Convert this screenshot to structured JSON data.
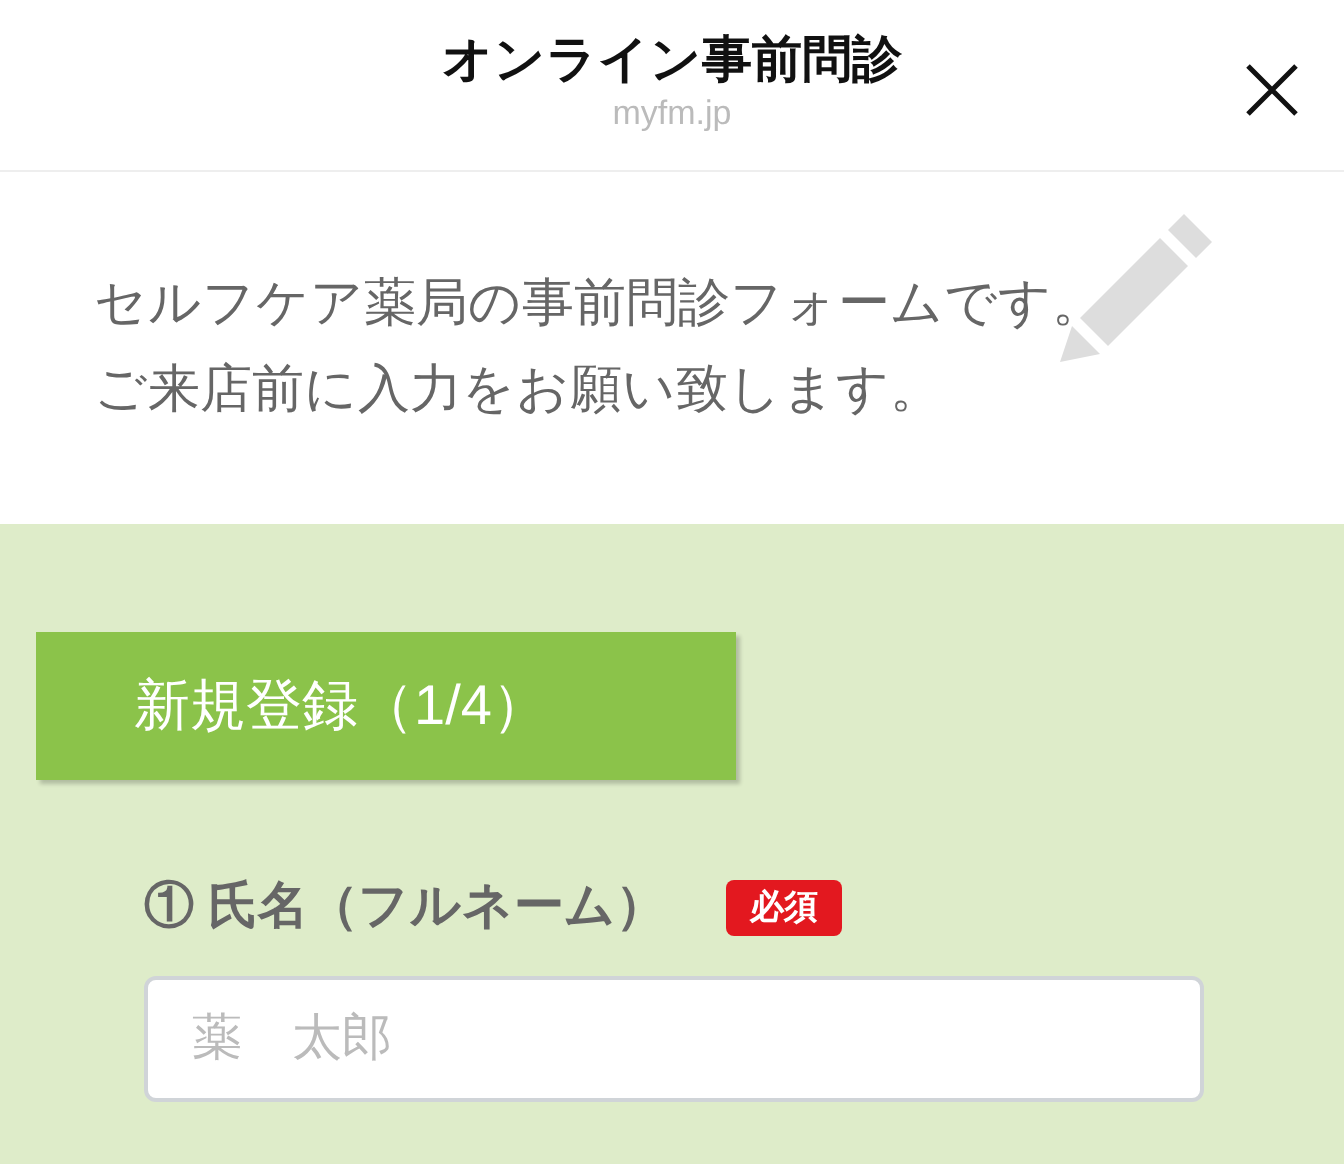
{
  "header": {
    "title": "オンライン事前問診",
    "domain": "myfm.jp"
  },
  "intro": {
    "lines": [
      "セルフケア薬局の事前問診フォームです。",
      "ご来店前に入力をお願い致します。"
    ]
  },
  "section": {
    "title": "新規登録（1/4）"
  },
  "fields": [
    {
      "label": "① 氏名（フルネーム）",
      "required": true,
      "required_label": "必須",
      "placeholder": "薬　太郎"
    }
  ]
}
